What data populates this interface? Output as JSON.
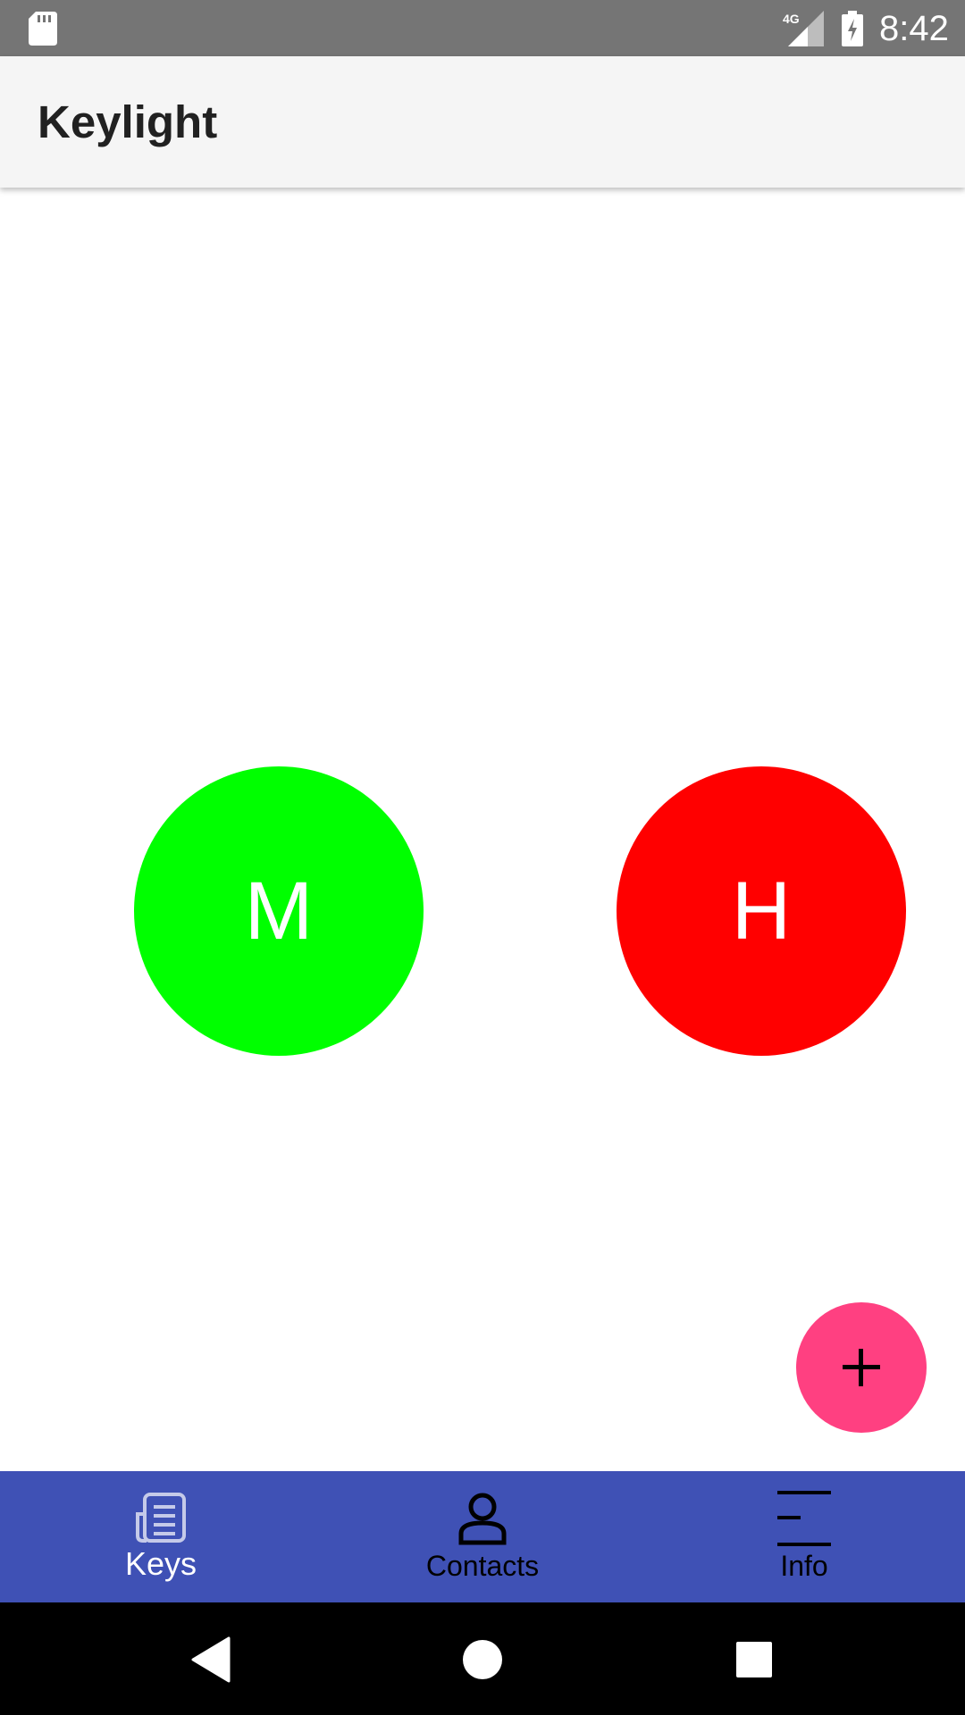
{
  "status_bar": {
    "time": "8:42",
    "network_label": "4G",
    "icons": [
      "sd-card-icon",
      "signal-4g-icon",
      "battery-charging-icon"
    ]
  },
  "app_bar": {
    "title": "Keylight"
  },
  "keys": [
    {
      "letter": "M",
      "color": "#00ff00"
    },
    {
      "letter": "H",
      "color": "#ff0000"
    }
  ],
  "fab": {
    "icon": "plus-icon",
    "color": "#ff4081"
  },
  "bottom_nav": {
    "background": "#3f51b5",
    "items": [
      {
        "label": "Keys",
        "icon": "keys-document-icon",
        "active": true
      },
      {
        "label": "Contacts",
        "icon": "person-icon",
        "active": false
      },
      {
        "label": "Info",
        "icon": "info-lines-icon",
        "active": false
      }
    ]
  },
  "system_nav": {
    "buttons": [
      "back-icon",
      "home-icon",
      "recents-icon"
    ]
  }
}
